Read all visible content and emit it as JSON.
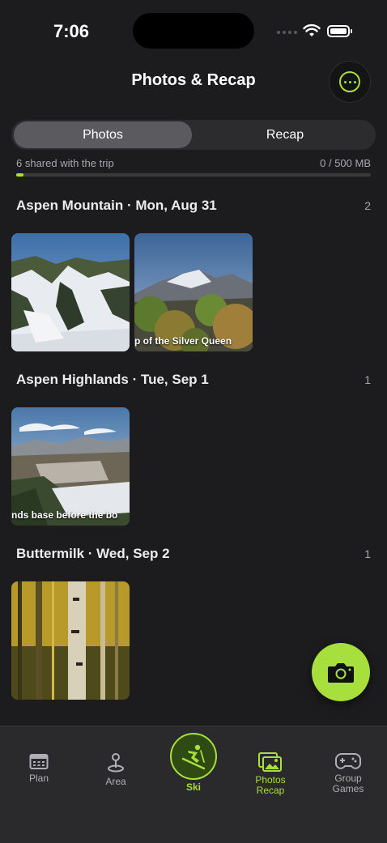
{
  "status_bar": {
    "time": "7:06"
  },
  "header": {
    "title": "Photos & Recap",
    "more_icon": "ellipsis-circle-icon"
  },
  "segmented": {
    "tabs": [
      "Photos",
      "Recap"
    ],
    "selected": "Photos"
  },
  "storage": {
    "shared_text": "6 shared with the trip",
    "usage_text": "0 / 500 MB",
    "usage_fraction": 0.02
  },
  "sections": [
    {
      "title": "Aspen Mountain · Mon, Aug 31",
      "count": "2",
      "photos": [
        {
          "caption": ""
        },
        {
          "caption": "p of the Silver Queen"
        }
      ]
    },
    {
      "title": "Aspen Highlands · Tue, Sep 1",
      "count": "1",
      "photos": [
        {
          "caption": "nds base before the bo"
        }
      ]
    },
    {
      "title": "Buttermilk · Wed, Sep 2",
      "count": "1",
      "photos": [
        {
          "caption": ""
        }
      ]
    }
  ],
  "fab": {
    "icon": "camera-icon"
  },
  "tabbar": {
    "items": [
      {
        "label": "Plan",
        "icon": "calendar-icon"
      },
      {
        "label": "Area",
        "icon": "map-pin-icon"
      },
      {
        "label": "Ski",
        "icon": "skier-icon"
      },
      {
        "label": "Photos Recap",
        "line1": "Photos",
        "line2": "Recap",
        "icon": "photos-icon"
      },
      {
        "label": "Group Games",
        "line1": "Group",
        "line2": "Games",
        "icon": "gamepad-icon"
      }
    ],
    "active_color": "#a7e03c"
  },
  "colors": {
    "accent": "#a7e03c",
    "background": "#1c1c1e"
  }
}
